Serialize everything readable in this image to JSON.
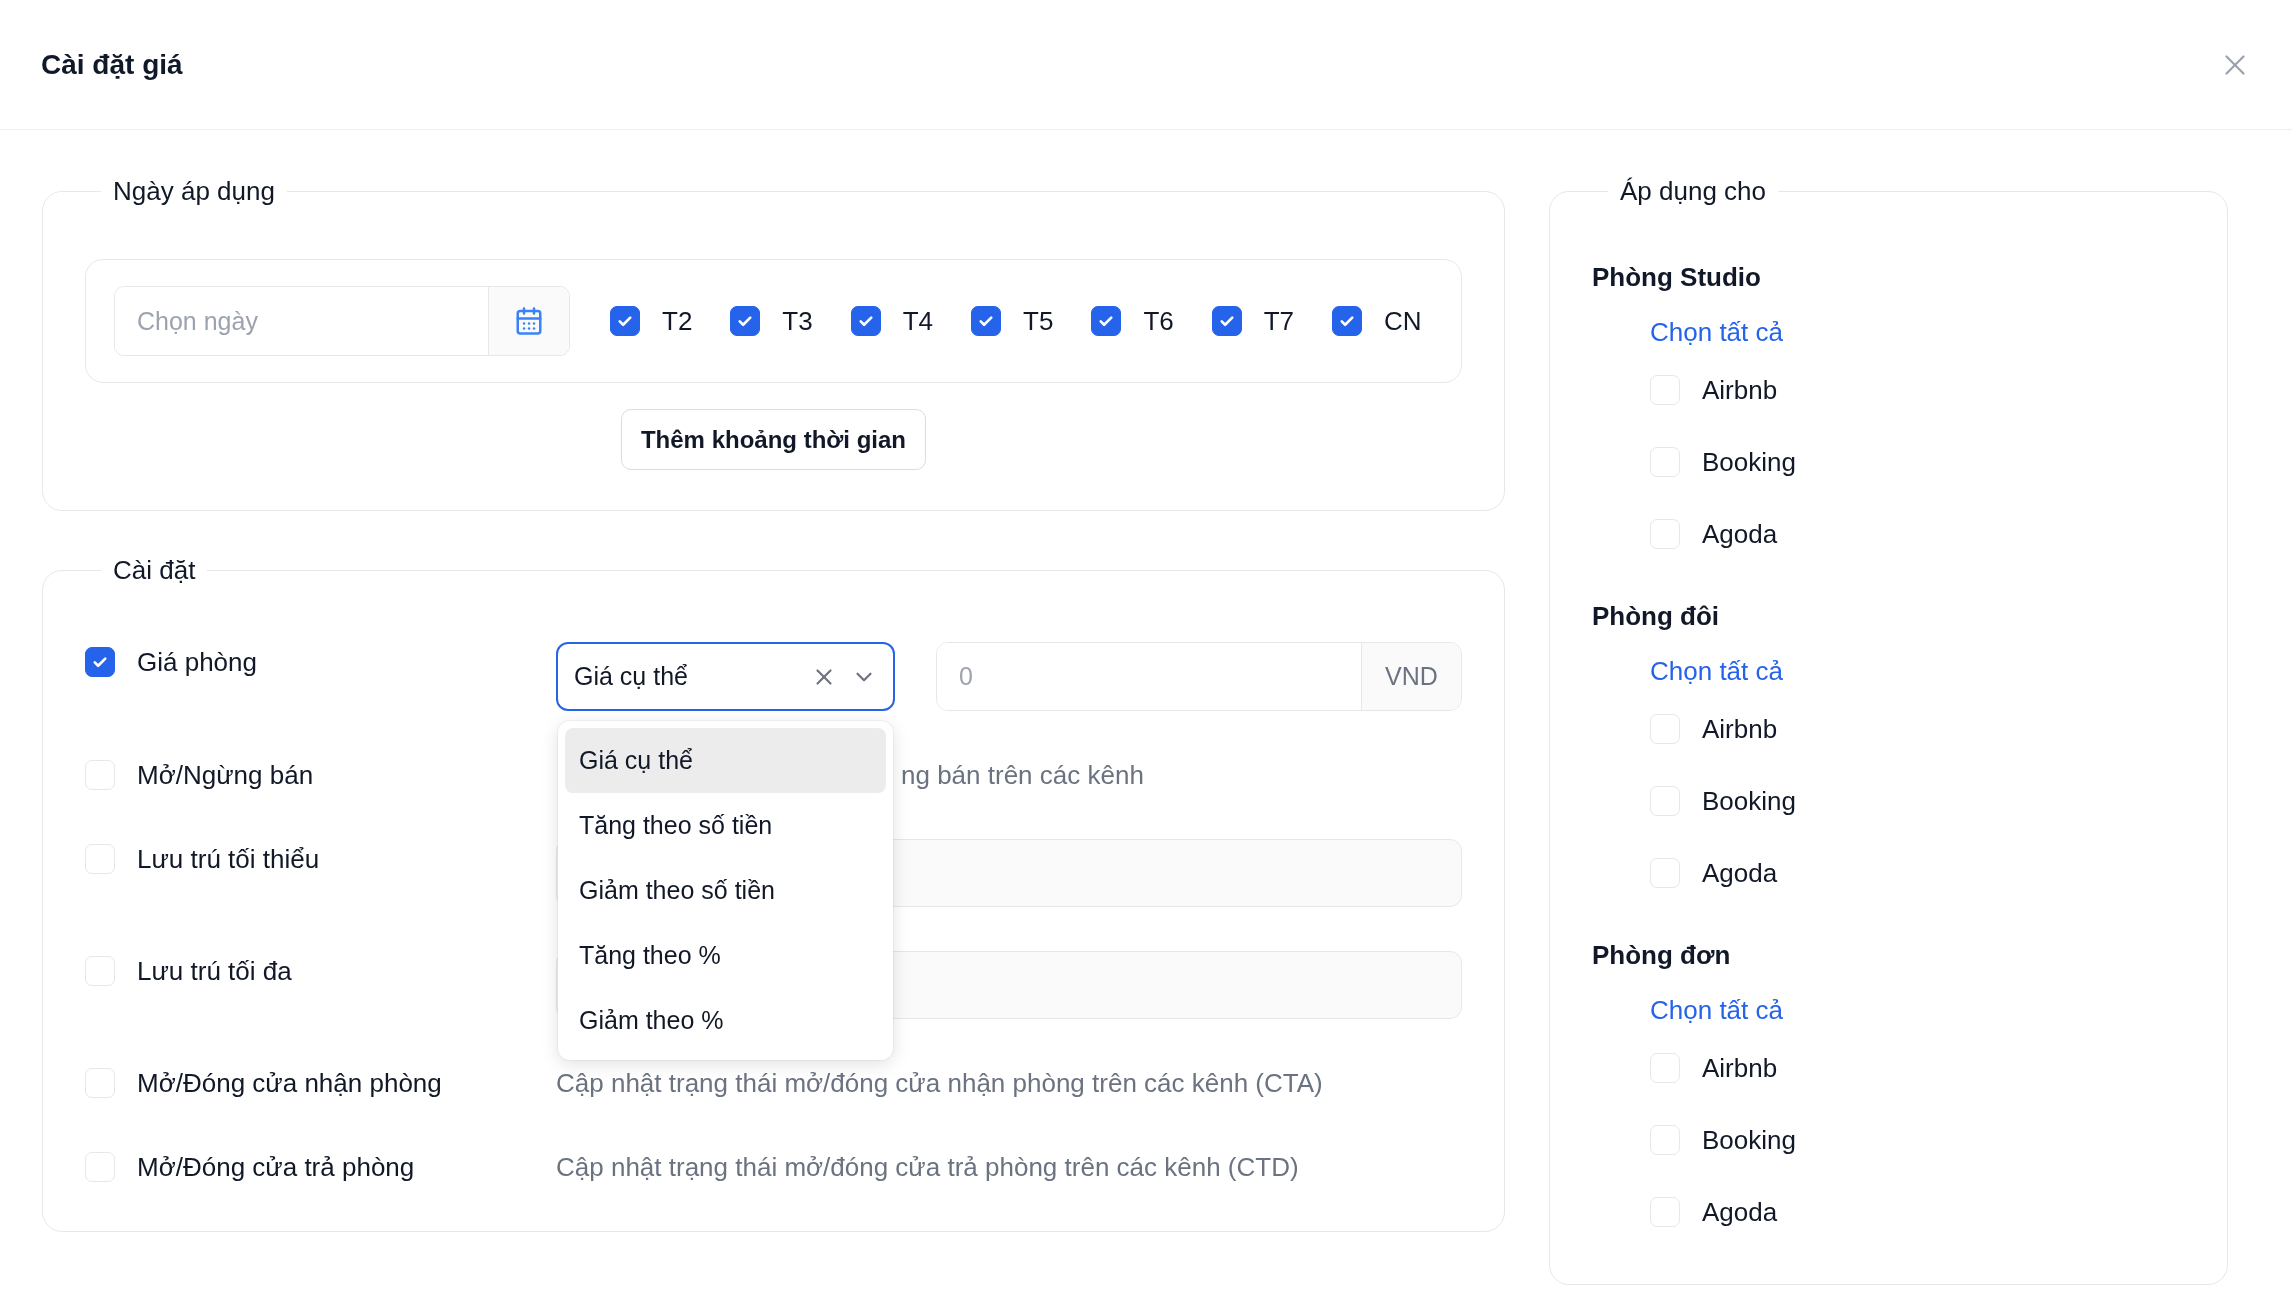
{
  "dialog": {
    "title": "Cài đặt giá"
  },
  "apply_dates": {
    "legend": "Ngày áp dụng",
    "date_field": {
      "placeholder": "Chọn ngày"
    },
    "weekdays": [
      {
        "label": "T2",
        "checked": true
      },
      {
        "label": "T3",
        "checked": true
      },
      {
        "label": "T4",
        "checked": true
      },
      {
        "label": "T5",
        "checked": true
      },
      {
        "label": "T6",
        "checked": true
      },
      {
        "label": "T7",
        "checked": true
      },
      {
        "label": "CN",
        "checked": true
      }
    ],
    "add_button": "Thêm khoảng thời gian"
  },
  "settings": {
    "legend": "Cài đặt",
    "rows": [
      {
        "kind": "price",
        "label": "Giá phòng",
        "checked": true,
        "select": {
          "value": "Giá cụ thể",
          "open": true,
          "options": [
            {
              "label": "Giá cụ thể",
              "selected": true
            },
            {
              "label": "Tăng theo số tiền",
              "selected": false
            },
            {
              "label": "Giảm theo số tiền",
              "selected": false
            },
            {
              "label": "Tăng theo %",
              "selected": false
            },
            {
              "label": "Giảm theo %",
              "selected": false
            }
          ]
        },
        "amount": {
          "placeholder": "0",
          "unit": "VND"
        }
      },
      {
        "kind": "covered_note",
        "label": "Mở/Ngừng bán",
        "checked": false,
        "note": "ng bán trên các kênh"
      },
      {
        "kind": "input",
        "label": "Lưu trú tối thiểu",
        "checked": false
      },
      {
        "kind": "input",
        "label": "Lưu trú tối đa",
        "checked": false
      },
      {
        "kind": "note",
        "label": "Mở/Đóng cửa nhận phòng",
        "checked": false,
        "note": "Cập nhật trạng thái mở/đóng cửa nhận phòng trên các kênh (CTA)"
      },
      {
        "kind": "note",
        "label": "Mở/Đóng cửa trả phòng",
        "checked": false,
        "note": "Cập nhật trạng thái mở/đóng cửa trả phòng trên các kênh (CTD)"
      }
    ]
  },
  "apply_to": {
    "legend": "Áp dụng cho",
    "groups": [
      {
        "title": "Phòng Studio",
        "select_all": "Chọn tất cả",
        "channels": [
          {
            "label": "Airbnb",
            "checked": false
          },
          {
            "label": "Booking",
            "checked": false
          },
          {
            "label": "Agoda",
            "checked": false
          }
        ]
      },
      {
        "title": "Phòng đôi",
        "select_all": "Chọn tất cả",
        "channels": [
          {
            "label": "Airbnb",
            "checked": false
          },
          {
            "label": "Booking",
            "checked": false
          },
          {
            "label": "Agoda",
            "checked": false
          }
        ]
      },
      {
        "title": "Phòng đơn",
        "select_all": "Chọn tất cả",
        "channels": [
          {
            "label": "Airbnb",
            "checked": false
          },
          {
            "label": "Booking",
            "checked": false
          },
          {
            "label": "Agoda",
            "checked": false
          }
        ]
      }
    ]
  }
}
